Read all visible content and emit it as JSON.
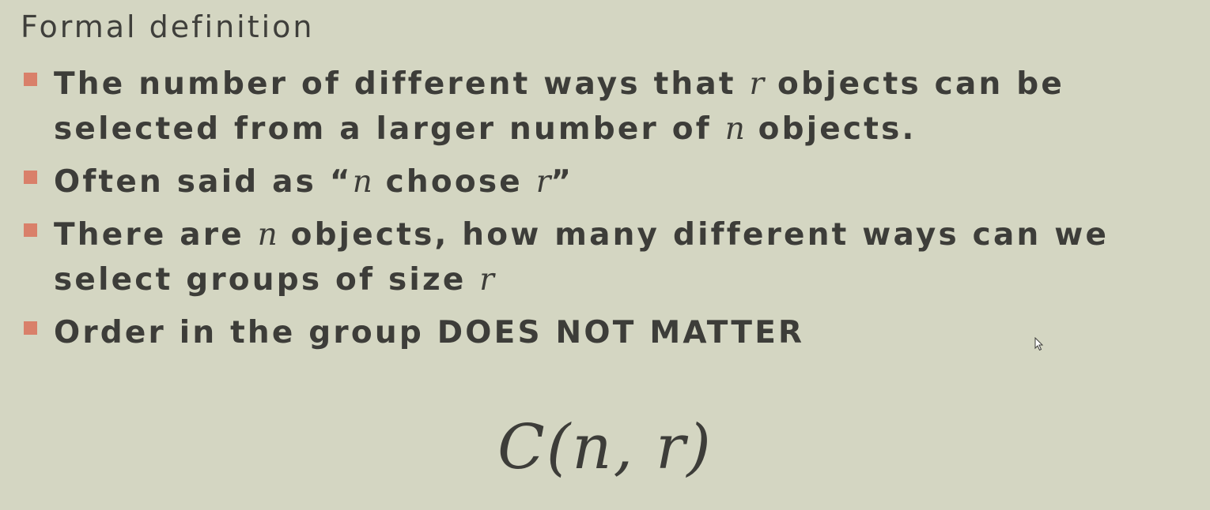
{
  "slide": {
    "heading": "Formal definition",
    "bullets": [
      {
        "parts": [
          "The number of different ways that ",
          "r",
          " objects can be selected from a larger number of ",
          "n",
          " objects."
        ]
      },
      {
        "parts": [
          "Often said as “",
          "n",
          " choose ",
          "r",
          "”"
        ]
      },
      {
        "parts": [
          "There are ",
          "n",
          " objects, how many different ways can we select groups of size ",
          "r",
          ""
        ]
      },
      {
        "parts": [
          "Order in the group DOES NOT MATTER"
        ]
      }
    ],
    "formula": "C(n, r)"
  },
  "colors": {
    "background": "#d4d6c2",
    "text": "#3d3d39",
    "bullet_marker": "#d9806a"
  },
  "icons": {
    "cursor": "mouse-pointer-icon"
  }
}
